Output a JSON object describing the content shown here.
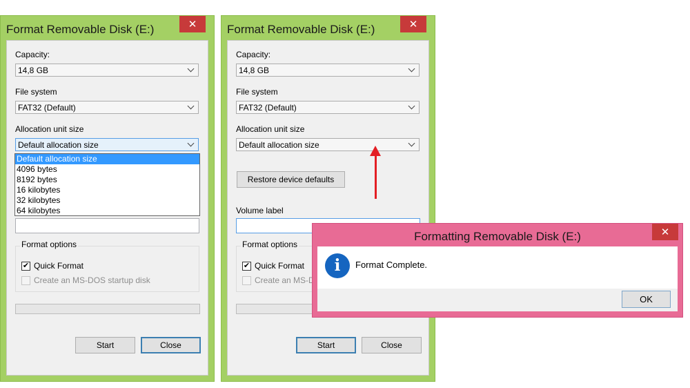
{
  "left_window": {
    "title": "Format Removable Disk (E:)",
    "capacity_label": "Capacity:",
    "capacity_value": "14,8 GB",
    "file_system_label": "File system",
    "file_system_value": "FAT32 (Default)",
    "allocation_label": "Allocation unit size",
    "allocation_value": "Default allocation size",
    "allocation_options": [
      "Default allocation size",
      "4096 bytes",
      "8192 bytes",
      "16 kilobytes",
      "32 kilobytes",
      "64 kilobytes"
    ],
    "format_options_label": "Format options",
    "quick_format_label": "Quick Format",
    "msdos_label": "Create an MS-DOS startup disk",
    "start_label": "Start",
    "close_label": "Close"
  },
  "right_window": {
    "title": "Format Removable Disk (E:)",
    "capacity_label": "Capacity:",
    "capacity_value": "14,8 GB",
    "file_system_label": "File system",
    "file_system_value": "FAT32 (Default)",
    "allocation_label": "Allocation unit size",
    "allocation_value": "Default allocation size",
    "restore_label": "Restore device defaults",
    "volume_label": "Volume label",
    "format_options_label": "Format options",
    "quick_format_label": "Quick Format",
    "msdos_label": "Create an MS-D",
    "start_label": "Start",
    "close_label": "Close"
  },
  "message_box": {
    "title": "Formatting Removable Disk (E:)",
    "message": "Format Complete.",
    "ok_label": "OK",
    "icon": "info-icon"
  },
  "colors": {
    "window_frame": "#a4d064",
    "message_frame": "#e86b95",
    "close_button": "#c73a3a",
    "arrow": "#e31e24"
  }
}
